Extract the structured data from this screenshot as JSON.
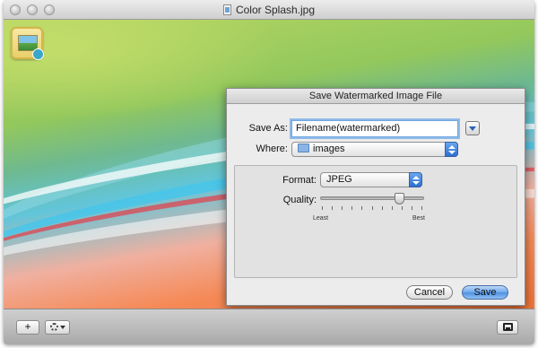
{
  "window": {
    "title": "Color Splash.jpg"
  },
  "dialog": {
    "title": "Save Watermarked Image File",
    "save_as_label": "Save As:",
    "filename": "Filename(watermarked)",
    "where_label": "Where:",
    "where_value": "images",
    "format_label": "Format:",
    "format_value": "JPEG",
    "quality_label": "Quality:",
    "quality_level": 0.76,
    "scale_min_label": "Least",
    "scale_max_label": "Best",
    "cancel_label": "Cancel",
    "save_label": "Save"
  },
  "toolbar": {
    "add_label": "+"
  },
  "icons": {
    "app": "photo-watermark-app-icon",
    "document": "document-icon",
    "folder": "folder-icon",
    "gear": "gear-icon",
    "photo": "photo-icon"
  },
  "colors": {
    "accent": "#4d90e0",
    "focus_ring": "#72aae8"
  }
}
